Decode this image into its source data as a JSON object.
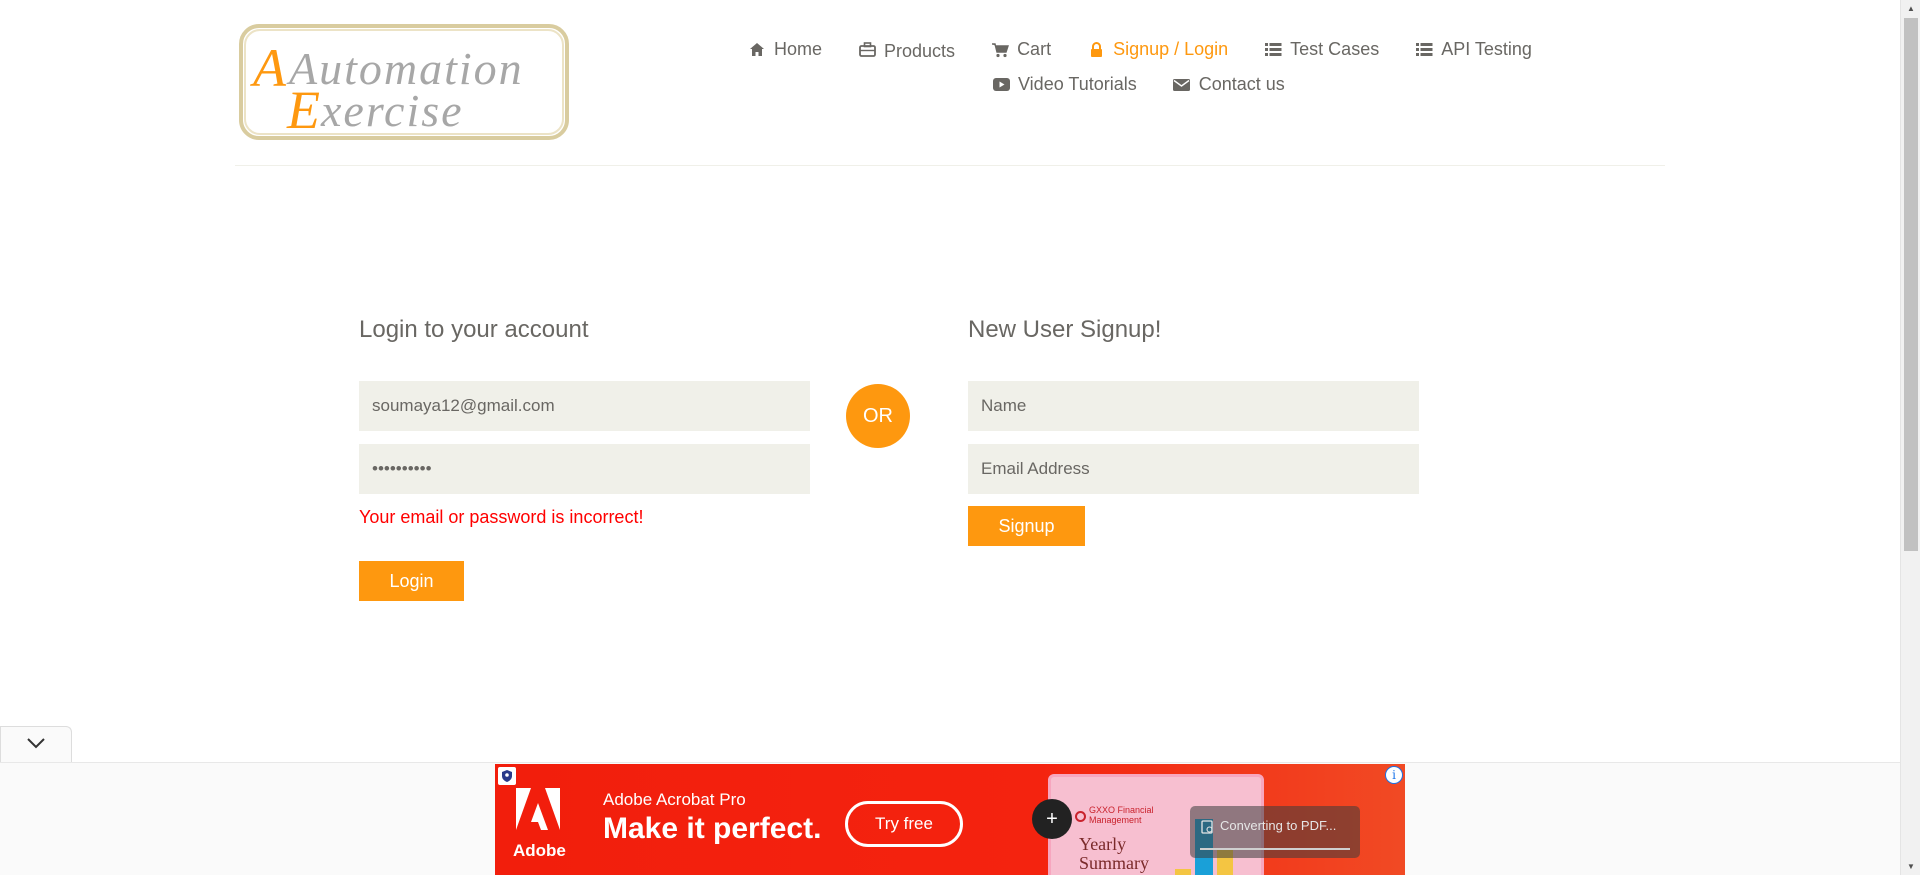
{
  "logo": {
    "line1": "Automation",
    "line2": "Exercise"
  },
  "nav": {
    "items": [
      {
        "label": "Home",
        "icon": "home-icon"
      },
      {
        "label": "Products",
        "icon": "briefcase-icon"
      },
      {
        "label": "Cart",
        "icon": "cart-icon"
      },
      {
        "label": "Signup / Login",
        "icon": "lock-icon",
        "active": true
      },
      {
        "label": "Test Cases",
        "icon": "list-icon"
      },
      {
        "label": "API Testing",
        "icon": "list-icon"
      },
      {
        "label": "Video Tutorials",
        "icon": "youtube-icon"
      },
      {
        "label": "Contact us",
        "icon": "envelope-icon"
      }
    ]
  },
  "login": {
    "title": "Login to your account",
    "email_value": "soumaya12@gmail.com",
    "password_value": "••••••••••",
    "error": "Your email or password is incorrect!",
    "button": "Login"
  },
  "or_label": "OR",
  "signup": {
    "title": "New User Signup!",
    "name_placeholder": "Name",
    "email_placeholder": "Email Address",
    "button": "Signup"
  },
  "ad": {
    "brand": "Adobe Acrobat Pro",
    "headline": "Make it perfect.",
    "cta": "Try free",
    "logo_text": "Adobe",
    "card_company": "GXXO Financial Management",
    "card_title_1": "Yearly",
    "card_title_2": "Summary",
    "converting": "Converting to PDF...",
    "plus": "+",
    "info": "i"
  },
  "colors": {
    "accent": "#FE980F",
    "text": "#696763",
    "field_bg": "#F0F0E9",
    "error": "#FF0000",
    "ad_red": "#F21E0C"
  }
}
